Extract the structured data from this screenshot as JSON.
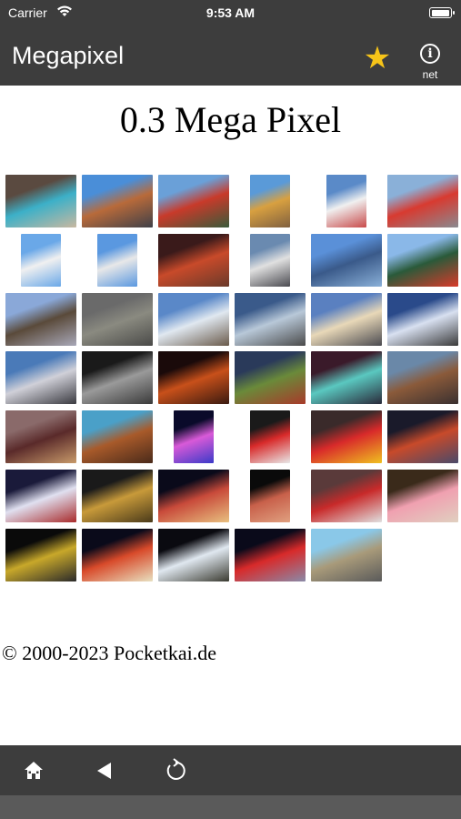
{
  "status_bar": {
    "carrier": "Carrier",
    "time": "9:53 AM"
  },
  "nav_bar": {
    "title": "Megapixel",
    "star_icon": "star-icon",
    "info_label": "net"
  },
  "page": {
    "title": "0.3 Mega Pixel",
    "copyright": "© 2000-2023 Pocketkai.de"
  },
  "thumbnails": [
    {
      "name": "thumb-pool",
      "colors": [
        "#5a4a40",
        "#3cb0c8",
        "#c8b8a0"
      ]
    },
    {
      "name": "thumb-street",
      "colors": [
        "#4a8ed8",
        "#b86a3a",
        "#404048"
      ]
    },
    {
      "name": "thumb-sign-1",
      "colors": [
        "#6aa0d8",
        "#c83a2a",
        "#3a5a3a"
      ]
    },
    {
      "name": "thumb-sign-2",
      "colors": [
        "#5a9ad8",
        "#d8a040",
        "#806040"
      ]
    },
    {
      "name": "thumb-sign-3",
      "colors": [
        "#5a8ac8",
        "#f0f0f0",
        "#c84a4a"
      ]
    },
    {
      "name": "thumb-sahara",
      "colors": [
        "#8ab0d8",
        "#d83a30",
        "#8a8a90"
      ]
    },
    {
      "name": "thumb-tower-1",
      "colors": [
        "#6aa8e8",
        "#f0f0f0",
        "#6aa8e8"
      ]
    },
    {
      "name": "thumb-tower-2",
      "colors": [
        "#5a98e0",
        "#e8e8e8",
        "#5a98e0"
      ]
    },
    {
      "name": "thumb-casino",
      "colors": [
        "#3a1a1a",
        "#c84a2a",
        "#6a3a2a"
      ]
    },
    {
      "name": "thumb-building",
      "colors": [
        "#6a8ab0",
        "#e0e0e0",
        "#4a4a50"
      ]
    },
    {
      "name": "thumb-glass",
      "colors": [
        "#5a90d8",
        "#3a5a8a",
        "#8ab0d8"
      ]
    },
    {
      "name": "thumb-free",
      "colors": [
        "#8ab8e8",
        "#2a5a3a",
        "#d83a2a"
      ]
    },
    {
      "name": "thumb-ship",
      "colors": [
        "#8aa8d8",
        "#5a4a3a",
        "#a8a8b8"
      ]
    },
    {
      "name": "thumb-statue",
      "colors": [
        "#6a6a6a",
        "#8a8a80",
        "#4a4a48"
      ]
    },
    {
      "name": "thumb-waterfall-1",
      "colors": [
        "#5a88c8",
        "#e0e8f0",
        "#6a5a4a"
      ]
    },
    {
      "name": "thumb-waterfall-2",
      "colors": [
        "#3a5a8a",
        "#b8c8d8",
        "#4a4a4a"
      ]
    },
    {
      "name": "thumb-facade",
      "colors": [
        "#5a80c0",
        "#e8d8b8",
        "#4a4a50"
      ]
    },
    {
      "name": "thumb-fountain-1",
      "colors": [
        "#2a4a8a",
        "#d8e0f0",
        "#3a3a3a"
      ]
    },
    {
      "name": "thumb-skyline",
      "colors": [
        "#4a7ab8",
        "#d0d0d8",
        "#3a3a40"
      ]
    },
    {
      "name": "thumb-tunnel",
      "colors": [
        "#1a1a1a",
        "#9a9a9a",
        "#3a3a3a"
      ]
    },
    {
      "name": "thumb-eiffel",
      "colors": [
        "#1a0a0a",
        "#c8501a",
        "#3a1a10"
      ]
    },
    {
      "name": "thumb-palms",
      "colors": [
        "#2a3a5a",
        "#6a8a3a",
        "#a83a2a"
      ]
    },
    {
      "name": "thumb-fountain-2",
      "colors": [
        "#3a1a2a",
        "#5ac8c0",
        "#2a2a3a"
      ]
    },
    {
      "name": "thumb-plaza",
      "colors": [
        "#6a88a8",
        "#8a5a3a",
        "#3a3030"
      ]
    },
    {
      "name": "thumb-venetian",
      "colors": [
        "#8a6a6a",
        "#5a2a2a",
        "#c89a6a"
      ]
    },
    {
      "name": "thumb-dome",
      "colors": [
        "#4aa0c8",
        "#a85a2a",
        "#4a2a1a"
      ]
    },
    {
      "name": "thumb-neon",
      "colors": [
        "#0a0a2a",
        "#d85ad8",
        "#3a3ac8"
      ]
    },
    {
      "name": "thumb-red-sign",
      "colors": [
        "#1a1a1a",
        "#d82a2a",
        "#e8e8e8"
      ]
    },
    {
      "name": "thumb-mms",
      "colors": [
        "#3a2a2a",
        "#d82a2a",
        "#f0c020"
      ]
    },
    {
      "name": "thumb-night-1",
      "colors": [
        "#1a1a2a",
        "#c84a2a",
        "#4a4a6a"
      ]
    },
    {
      "name": "thumb-excalibur",
      "colors": [
        "#1a1a3a",
        "#e0e0f0",
        "#a82a2a"
      ]
    },
    {
      "name": "thumb-lion",
      "colors": [
        "#1a1a1a",
        "#c89a3a",
        "#4a3a1a"
      ]
    },
    {
      "name": "thumb-newyork-1",
      "colors": [
        "#0a0a1a",
        "#c84a3a",
        "#e8c080"
      ]
    },
    {
      "name": "thumb-newyork-2",
      "colors": [
        "#0a0a0a",
        "#c8604a",
        "#e0a080"
      ]
    },
    {
      "name": "thumb-car-red",
      "colors": [
        "#5a3a3a",
        "#c82a2a",
        "#e0e0e0"
      ]
    },
    {
      "name": "thumb-people",
      "colors": [
        "#3a2a1a",
        "#f0a0b0",
        "#e0d0c0"
      ]
    },
    {
      "name": "thumb-jeep",
      "colors": [
        "#0a0a0a",
        "#c8a82a",
        "#2a2a2a"
      ]
    },
    {
      "name": "thumb-strip-night",
      "colors": [
        "#0a0a1a",
        "#d84a2a",
        "#e8e0c0"
      ]
    },
    {
      "name": "thumb-bellagio",
      "colors": [
        "#0a0a10",
        "#e0e8f0",
        "#3a3a30"
      ]
    },
    {
      "name": "thumb-aerial",
      "colors": [
        "#0a0a1a",
        "#d82a2a",
        "#8a8aa8"
      ]
    },
    {
      "name": "thumb-desert-road",
      "colors": [
        "#8ac8e8",
        "#a89a7a",
        "#5a5a5a"
      ]
    }
  ]
}
